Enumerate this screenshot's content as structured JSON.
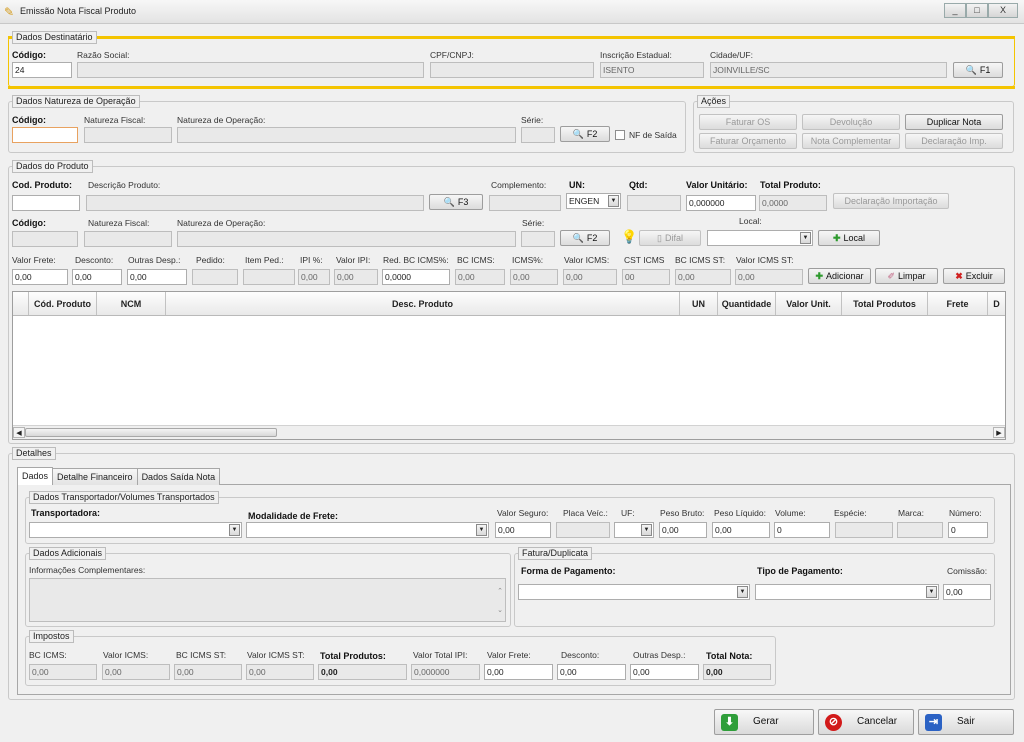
{
  "window": {
    "title": "Emissão Nota Fiscal Produto",
    "btn_min": "_",
    "btn_max": "□",
    "btn_close": "X"
  },
  "dest": {
    "legend": "Dados Destinatário",
    "codigo_label": "Código:",
    "codigo_value": "24",
    "razao_label": "Razão Social:",
    "razao_value": "",
    "cpf_label": "CPF/CNPJ:",
    "cpf_value": "",
    "ie_label": "Inscrição Estadual:",
    "ie_value": "ISENTO",
    "cidade_label": "Cidade/UF:",
    "cidade_value": "JOINVILLE/SC",
    "search_btn": "F1"
  },
  "natureza": {
    "legend": "Dados Natureza de Operação",
    "codigo_label": "Código:",
    "nat_fiscal_label": "Natureza Fiscal:",
    "nat_op_label": "Natureza de Operação:",
    "serie_label": "Série:",
    "search_btn": "F2",
    "nf_saida_label": "NF de Saída"
  },
  "acoes": {
    "legend": "Ações",
    "buttons": [
      "Faturar OS",
      "Devolução",
      "Duplicar Nota",
      "Faturar Orçamento",
      "Nota Complementar",
      "Declaração Imp."
    ]
  },
  "produto": {
    "legend": "Dados do Produto",
    "cod_label": "Cod. Produto:",
    "desc_label": "Descrição Produto:",
    "search_btn": "F3",
    "complemento_label": "Complemento:",
    "un_label": "UN:",
    "un_value": "ENGEN",
    "qtd_label": "Qtd:",
    "valor_unit_label": "Valor Unitário:",
    "valor_unit_value": "0,000000",
    "total_label": "Total Produto:",
    "total_value": "0,0000",
    "decl_btn": "Declaração Importação",
    "codigo_label": "Código:",
    "nat_fiscal_label": "Natureza Fiscal:",
    "nat_op_label": "Natureza de Operação:",
    "serie_label": "Série:",
    "search_btn2": "F2",
    "difal_btn": "Difal",
    "local_label": "Local:",
    "local_btn": "Local",
    "row3_labels": [
      "Valor Frete:",
      "Desconto:",
      "Outras Desp.:",
      "Pedido:",
      "Item Ped.:",
      "IPI %:",
      "Valor IPI:",
      "Red. BC ICMS%:",
      "BC ICMS:",
      "ICMS%:",
      "Valor ICMS:",
      "CST ICMS",
      "BC ICMS ST:",
      "Valor ICMS ST:"
    ],
    "row3_values": [
      "0,00",
      "0,00",
      "0,00",
      "",
      "",
      "0,00",
      "0,00",
      "0,0000",
      "0,00",
      "0,00",
      "0,00",
      "00",
      "0,00",
      "0,00"
    ],
    "add_btn": "Adicionar",
    "clear_btn": "Limpar",
    "del_btn": "Excluir"
  },
  "grid": {
    "columns": [
      "Cód. Produto",
      "NCM",
      "Desc. Produto",
      "UN",
      "Quantidade",
      "Valor Unit.",
      "Total Produtos",
      "Frete",
      "D"
    ]
  },
  "detalhes": {
    "legend": "Detalhes",
    "tabs": [
      "Dados",
      "Detalhe Financeiro",
      "Dados Saída Nota"
    ],
    "transp_legend": "Dados Transportador/Volumes Transportados",
    "transportadora_label": "Transportadora:",
    "modalidade_label": "Modalidade de Frete:",
    "transp_labels": [
      "Valor Seguro:",
      "Placa Veíc.:",
      "UF:",
      "Peso Bruto:",
      "Peso Líquido:",
      "Volume:",
      "Espécie:",
      "Marca:",
      "Número:"
    ],
    "transp_values": [
      "0,00",
      "",
      "",
      "0,00",
      "0,00",
      "0",
      "",
      "",
      "0"
    ],
    "adic_legend": "Dados Adicionais",
    "info_label": "Informações Complementares:",
    "fatura_legend": "Fatura/Duplicata",
    "forma_label": "Forma de Pagamento:",
    "tipo_label": "Tipo de Pagamento:",
    "comissao_label": "Comissão:",
    "comissao_value": "0,00",
    "impostos_legend": "Impostos",
    "imp_labels": [
      "BC ICMS:",
      "Valor ICMS:",
      "BC ICMS ST:",
      "Valor ICMS ST:",
      "Total Produtos:",
      "Valor Total IPI:",
      "Valor Frete:",
      "Desconto:",
      "Outras Desp.:",
      "Total Nota:"
    ],
    "imp_values": [
      "0,00",
      "0,00",
      "0,00",
      "0,00",
      "0,00",
      "0,000000",
      "0,00",
      "0,00",
      "0,00",
      "0,00"
    ]
  },
  "footer": {
    "gerar": "Gerar",
    "cancelar": "Cancelar",
    "sair": "Sair"
  }
}
